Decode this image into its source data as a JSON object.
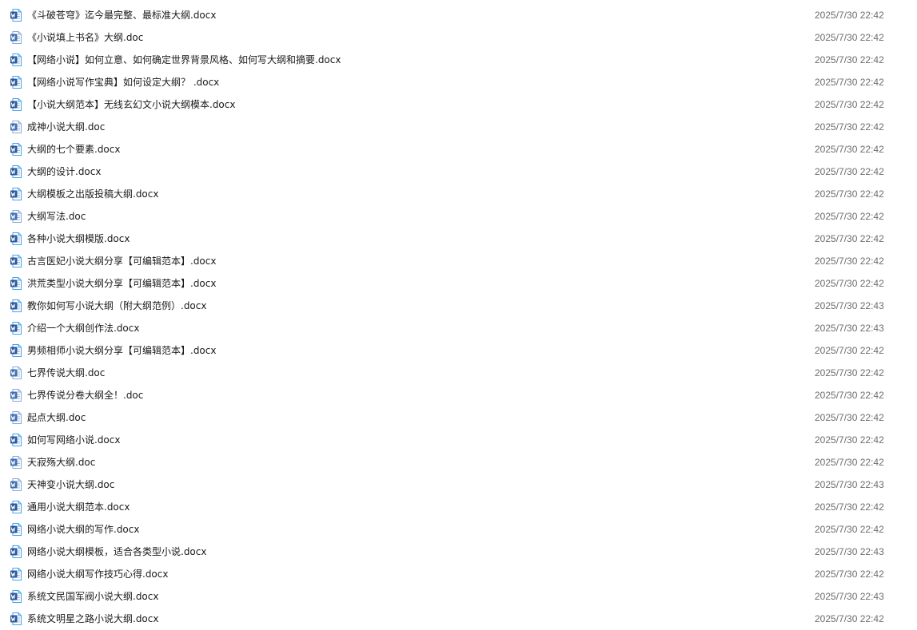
{
  "file_icon": "word-document-icon",
  "colors": {
    "icon_blue": "#2b579a",
    "icon_light_blue": "#41a5ee",
    "date_text": "#6d6d6d",
    "name_text": "#1a1a1a"
  },
  "files": [
    {
      "name": "《斗破苍穹》迄今最完整、最标准大纲.docx",
      "modified": "2025/7/30 22:42",
      "kind": "docx"
    },
    {
      "name": "《小说填上书名》大纲.doc",
      "modified": "2025/7/30 22:42",
      "kind": "doc"
    },
    {
      "name": "【网络小说】如何立意、如何确定世界背景风格、如何写大纲和摘要.docx",
      "modified": "2025/7/30 22:42",
      "kind": "docx"
    },
    {
      "name": "【网络小说写作宝典】如何设定大纲？ .docx",
      "modified": "2025/7/30 22:42",
      "kind": "docx"
    },
    {
      "name": "【小说大纲范本】无线玄幻文小说大纲模本.docx",
      "modified": "2025/7/30 22:42",
      "kind": "docx"
    },
    {
      "name": "成神小说大纲.doc",
      "modified": "2025/7/30 22:42",
      "kind": "doc"
    },
    {
      "name": "大纲的七个要素.docx",
      "modified": "2025/7/30 22:42",
      "kind": "docx"
    },
    {
      "name": "大纲的设计.docx",
      "modified": "2025/7/30 22:42",
      "kind": "docx"
    },
    {
      "name": "大纲模板之出版投稿大纲.docx",
      "modified": "2025/7/30 22:42",
      "kind": "docx"
    },
    {
      "name": "大纲写法.doc",
      "modified": "2025/7/30 22:42",
      "kind": "doc"
    },
    {
      "name": "各种小说大纲模版.docx",
      "modified": "2025/7/30 22:42",
      "kind": "docx"
    },
    {
      "name": "古言医妃小说大纲分享【可编辑范本】.docx",
      "modified": "2025/7/30 22:42",
      "kind": "docx"
    },
    {
      "name": "洪荒类型小说大纲分享【可编辑范本】.docx",
      "modified": "2025/7/30 22:42",
      "kind": "docx"
    },
    {
      "name": "教你如何写小说大纲（附大纲范例）.docx",
      "modified": "2025/7/30 22:43",
      "kind": "docx"
    },
    {
      "name": "介绍一个大纲创作法.docx",
      "modified": "2025/7/30 22:43",
      "kind": "docx"
    },
    {
      "name": "男频相师小说大纲分享【可编辑范本】.docx",
      "modified": "2025/7/30 22:42",
      "kind": "docx"
    },
    {
      "name": "七界传说大纲.doc",
      "modified": "2025/7/30 22:42",
      "kind": "doc"
    },
    {
      "name": "七界传说分卷大纲全！.doc",
      "modified": "2025/7/30 22:42",
      "kind": "doc"
    },
    {
      "name": "起点大纲.doc",
      "modified": "2025/7/30 22:42",
      "kind": "doc"
    },
    {
      "name": "如何写网络小说.docx",
      "modified": "2025/7/30 22:42",
      "kind": "docx"
    },
    {
      "name": "天寂殇大纲.doc",
      "modified": "2025/7/30 22:42",
      "kind": "doc"
    },
    {
      "name": "天神变小说大纲.doc",
      "modified": "2025/7/30 22:43",
      "kind": "doc"
    },
    {
      "name": "通用小说大纲范本.docx",
      "modified": "2025/7/30 22:42",
      "kind": "docx"
    },
    {
      "name": "网络小说大纲的写作.docx",
      "modified": "2025/7/30 22:42",
      "kind": "docx"
    },
    {
      "name": "网络小说大纲模板，适合各类型小说.docx",
      "modified": "2025/7/30 22:43",
      "kind": "docx"
    },
    {
      "name": "网络小说大纲写作技巧心得.docx",
      "modified": "2025/7/30 22:42",
      "kind": "docx"
    },
    {
      "name": "系统文民国军阀小说大纲.docx",
      "modified": "2025/7/30 22:43",
      "kind": "docx"
    },
    {
      "name": "系统文明星之路小说大纲.docx",
      "modified": "2025/7/30 22:42",
      "kind": "docx"
    }
  ]
}
